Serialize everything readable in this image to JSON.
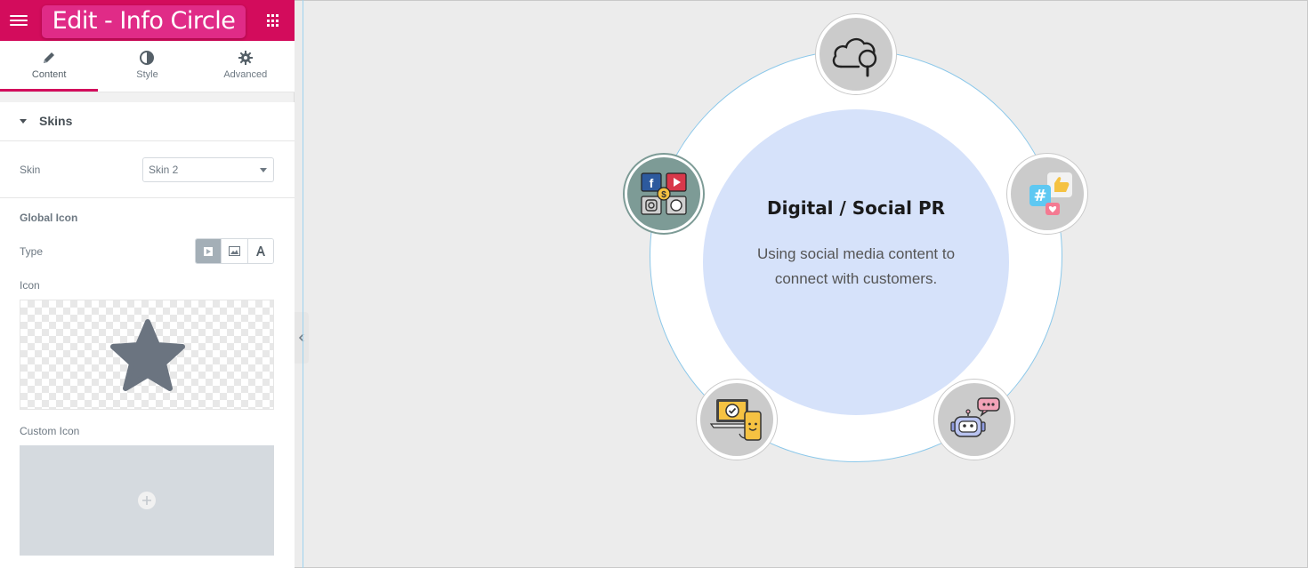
{
  "header": {
    "title": "Edit - Info Circle"
  },
  "tabs": [
    {
      "label": "Content",
      "icon": "pencil-icon",
      "active": true
    },
    {
      "label": "Style",
      "icon": "half-circle-icon",
      "active": false
    },
    {
      "label": "Advanced",
      "icon": "gear-icon",
      "active": false
    }
  ],
  "section": {
    "skins_label": "Skins"
  },
  "controls": {
    "skin_label": "Skin",
    "skin_value": "Skin 2",
    "global_icon_heading": "Global Icon",
    "type_label": "Type",
    "icon_label": "Icon",
    "custom_icon_label": "Custom Icon"
  },
  "info_circle": {
    "title": "Digital / Social PR",
    "description": "Using social media content to connect with customers.",
    "items": [
      {
        "icon": "cloud-search-icon"
      },
      {
        "icon": "social-hashtag-like-icon"
      },
      {
        "icon": "chatbot-icon"
      },
      {
        "icon": "laptop-phone-icon"
      },
      {
        "icon": "social-media-apps-icon",
        "active": true
      }
    ]
  },
  "colors": {
    "brand": "#d30c5c",
    "title_pill": "#e02b87",
    "center_fill": "#d6e2fa",
    "ring_border": "#8cc8ea",
    "active_item": "#7d9b96"
  }
}
